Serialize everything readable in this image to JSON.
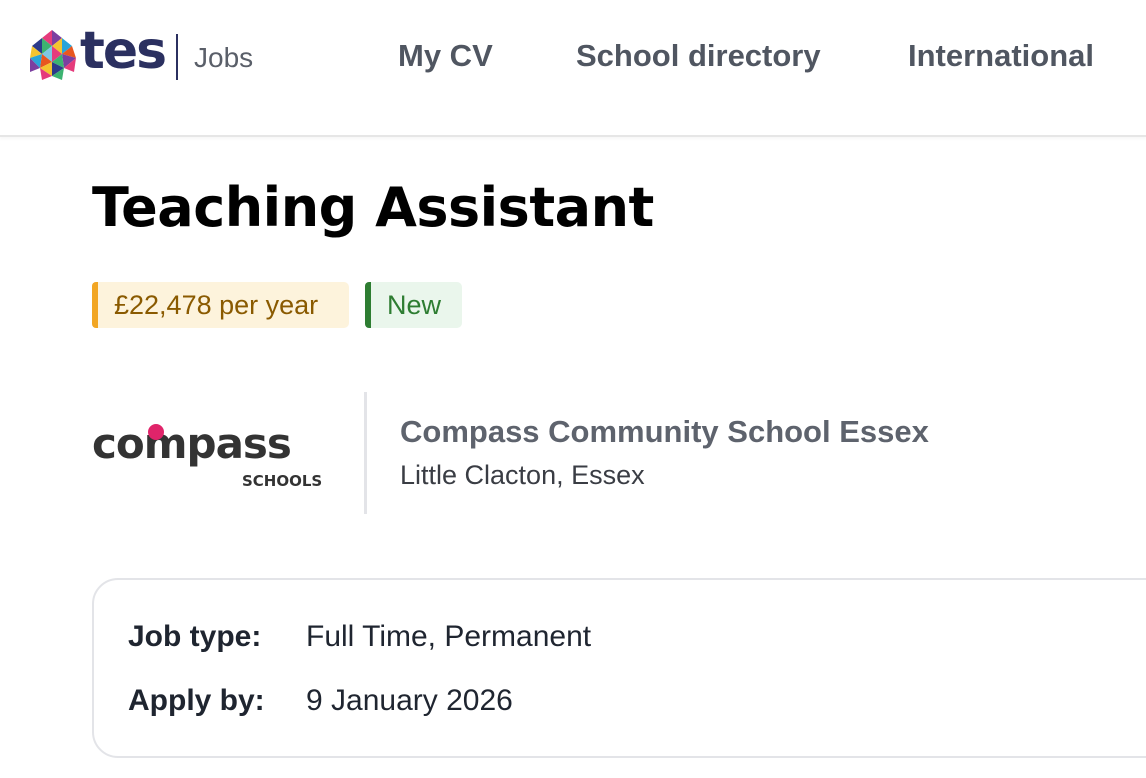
{
  "header": {
    "logo_text": "tes",
    "logo_subtitle": "Jobs",
    "nav": [
      {
        "label": "My CV"
      },
      {
        "label": "School directory"
      },
      {
        "label": "International"
      }
    ]
  },
  "job": {
    "title": "Teaching Assistant",
    "tags": {
      "salary": "£22,478 per year",
      "status": "New"
    },
    "school": {
      "logo_text": "compass",
      "logo_subtext": "SCHOOLS",
      "name": "Compass Community School Essex",
      "location": "Little Clacton, Essex"
    },
    "details": [
      {
        "label": "Job type:",
        "value": "Full Time, Permanent"
      },
      {
        "label": "Apply by:",
        "value": "9 January 2026"
      }
    ]
  },
  "colors": {
    "brand_navy": "#2b3060",
    "salary_accent": "#f2a623",
    "new_accent": "#2e7d32",
    "compass_pink": "#e0246a"
  }
}
